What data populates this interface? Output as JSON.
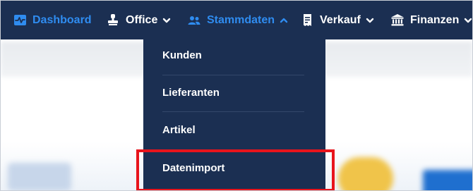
{
  "nav": {
    "items": [
      {
        "label": "Dashboard",
        "icon": "chart-pulse-icon",
        "active": true
      },
      {
        "label": "Office",
        "icon": "stamp-icon",
        "caret": "chevron-down-icon"
      },
      {
        "label": "Stammdaten",
        "icon": "users-icon",
        "caret": "chevron-up-icon",
        "open": true
      },
      {
        "label": "Verkauf",
        "icon": "receipt-icon",
        "caret": "chevron-down-icon"
      },
      {
        "label": "Finanzen",
        "icon": "bank-icon",
        "caret": "chevron-down-icon"
      }
    ]
  },
  "dropdown": {
    "items": [
      {
        "label": "Kunden"
      },
      {
        "label": "Lieferanten"
      },
      {
        "label": "Artikel"
      },
      {
        "label": "Datenimport",
        "highlighted": true
      }
    ]
  },
  "colors": {
    "navbar_bg": "#1b2f52",
    "active_blue": "#2f8cf0",
    "text_white": "#ffffff",
    "highlight_red": "#e8141c"
  }
}
